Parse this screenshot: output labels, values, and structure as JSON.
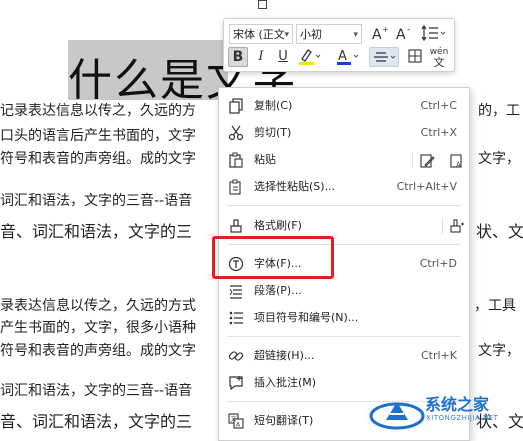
{
  "document": {
    "heading": "什么是文字",
    "lines": [
      {
        "text": "记录表达信息以传之，久远的方",
        "right": "的，工",
        "size": "s"
      },
      {
        "text": "口头的语言后产生书面的，文字",
        "right": "",
        "size": "s"
      },
      {
        "text": "符号和表音的声旁组。成的文字",
        "right": "文字，",
        "size": "s"
      },
      {
        "text": "词汇和语法，文字的三音--语音",
        "right": "",
        "size": "s"
      },
      {
        "text": "音、词汇和语法，文字的三",
        "right": "状、文",
        "size": "l"
      },
      {
        "text": "录表达信息以传之，久远的方式",
        "right": "，工具",
        "size": "s"
      },
      {
        "text": "产生书面的，文字，很多小语种",
        "right": "",
        "size": "s"
      },
      {
        "text": "符号和表音的声旁组。成的文字",
        "right": "文字，",
        "size": "s"
      },
      {
        "text": "词汇和语法，文字的三音--语音",
        "right": "",
        "size": "s"
      },
      {
        "text": "音、词汇和语法，文字的三",
        "right": "状、文",
        "size": "l"
      }
    ]
  },
  "toolbar": {
    "font_name": "宋体 (正文",
    "font_size": "小初",
    "grow_font_icon": "A+",
    "shrink_font_icon": "A-",
    "line_spacing_icon": "line-spacing",
    "bold_label": "B",
    "italic_label": "I",
    "underline_label": "U",
    "font_color_label": "A",
    "highlight_color": "#f2e600",
    "font_color": "#1a3fd6",
    "pinyin_label": "wén"
  },
  "menu": {
    "items": [
      {
        "label": "复制(C)",
        "shortcut": "Ctrl+C",
        "icon": "copy-icon"
      },
      {
        "label": "剪切(T)",
        "shortcut": "Ctrl+X",
        "icon": "cut-icon"
      },
      {
        "label": "粘贴",
        "shortcut": "",
        "icon": "paste-icon"
      },
      {
        "label": "选择性粘贴(S)...",
        "shortcut": "Ctrl+Alt+V",
        "icon": "paste-special-icon"
      },
      {
        "label": "格式刷(F)",
        "shortcut": "",
        "icon": "format-painter-icon"
      },
      {
        "label": "字体(F)...",
        "shortcut": "Ctrl+D",
        "icon": "font-icon"
      },
      {
        "label": "段落(P)...",
        "shortcut": "",
        "icon": "paragraph-icon"
      },
      {
        "label": "项目符号和编号(N)...",
        "shortcut": "",
        "icon": "bullets-icon"
      },
      {
        "label": "超链接(H)...",
        "shortcut": "Ctrl+K",
        "icon": "link-icon"
      },
      {
        "label": "插入批注(M)",
        "shortcut": "",
        "icon": "comment-icon"
      },
      {
        "label": "短句翻译(T)",
        "shortcut": "",
        "icon": "translate-icon"
      }
    ]
  },
  "highlight_box_color": "#e02020",
  "watermark": {
    "label": "系统之家",
    "sub": "XITONGZHIJIA.NET"
  }
}
